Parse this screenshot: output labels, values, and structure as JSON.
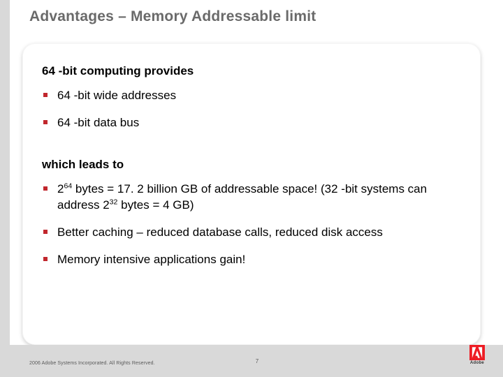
{
  "title": "Advantages – Memory Addressable limit",
  "sections": {
    "s1": {
      "heading": "64 -bit computing provides",
      "bullets": [
        "64 -bit wide addresses",
        "64 -bit data bus"
      ]
    },
    "s2": {
      "heading": "which leads to",
      "bullets_html": [
        "2<sup>64</sup> bytes = 17. 2 billion GB of addressable space! (32 -bit systems can address 2<sup>32</sup> bytes = 4 GB)",
        "Better caching – reduced database calls, reduced disk access",
        "Memory intensive applications gain!"
      ]
    }
  },
  "footer": {
    "copyright": "2006 Adobe Systems Incorporated. All Rights Reserved.",
    "page_number": "7",
    "logo_label": "Adobe"
  },
  "colors": {
    "bullet": "#c1272d",
    "title": "#6a6a6a",
    "logo": "#ed1c24"
  }
}
